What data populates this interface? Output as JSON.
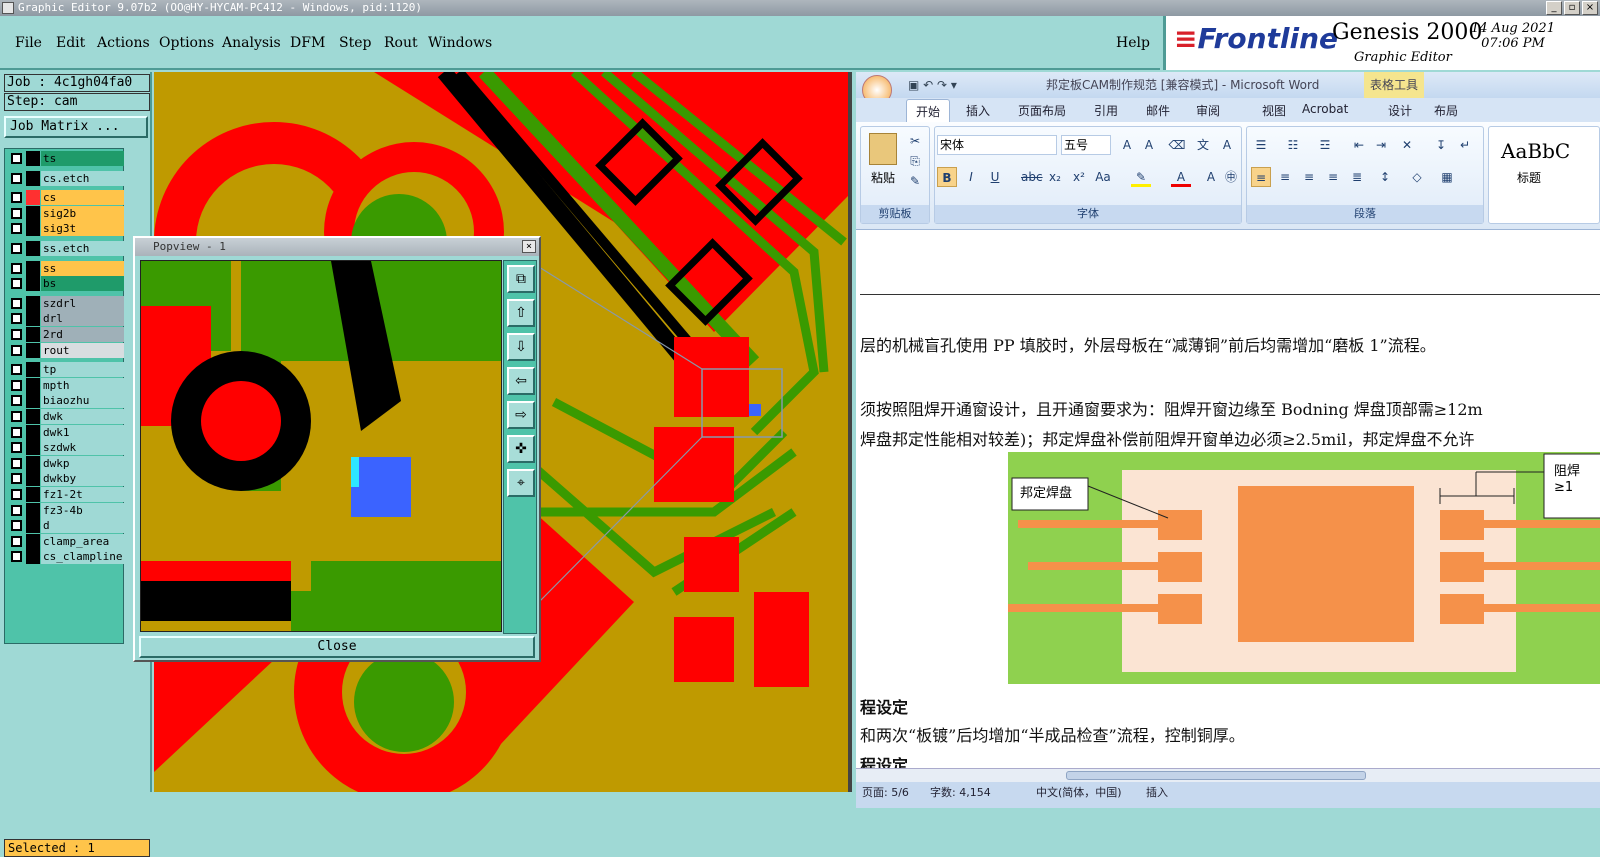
{
  "window": {
    "title": "Graphic Editor 9.07b2 (OO@HY-HYCAM-PC412 - Windows, pid:1120)"
  },
  "menu": {
    "file": "File",
    "edit": "Edit",
    "actions": "Actions",
    "options": "Options",
    "analysis": "Analysis",
    "dfm": "DFM",
    "step": "Step",
    "rout": "Rout",
    "windows": "Windows",
    "help": "Help"
  },
  "brand": {
    "logo": "Frontline",
    "product": "Genesis 2000",
    "subtitle": "Graphic Editor",
    "date": "14 Aug 2021",
    "time": "07:06 PM"
  },
  "job": {
    "job_label": "Job : 4c1gh04fa0",
    "step_label": "Step: cam",
    "matrix_button": "Job Matrix ..."
  },
  "layers": [
    {
      "name": "ts",
      "color": "#1f9b6a"
    },
    {
      "name": "cs.etch",
      "color": "#9fd9d5"
    },
    {
      "name": "cs",
      "color": "#ffc44a"
    },
    {
      "name": "sig2b",
      "color": "#ffc44a"
    },
    {
      "name": "sig3t",
      "color": "#ffc44a"
    },
    {
      "name": "ss.etch",
      "color": "#9fd9d5"
    },
    {
      "name": "ss",
      "color": "#ffc44a"
    },
    {
      "name": "bs",
      "color": "#1f9b6a"
    },
    {
      "name": "szdrl",
      "color": "#9fb0b8"
    },
    {
      "name": "drl",
      "color": "#9fb0b8"
    },
    {
      "name": "2rd",
      "color": "#9fb0b8"
    },
    {
      "name": "rout",
      "color": "#d8dde0"
    },
    {
      "name": "tp",
      "color": "#9fd9d5"
    },
    {
      "name": "mpth",
      "color": "#9fd9d5"
    },
    {
      "name": "biaozhu",
      "color": "#9fd9d5"
    },
    {
      "name": "dwk",
      "color": "#9fd9d5"
    },
    {
      "name": "dwk1",
      "color": "#9fd9d5"
    },
    {
      "name": "szdwk",
      "color": "#9fd9d5"
    },
    {
      "name": "dwkp",
      "color": "#9fd9d5"
    },
    {
      "name": "dwkby",
      "color": "#9fd9d5"
    },
    {
      "name": "fz1-2t",
      "color": "#9fd9d5"
    },
    {
      "name": "fz3-4b",
      "color": "#9fd9d5"
    },
    {
      "name": "d",
      "color": "#9fd9d5"
    },
    {
      "name": "clamp_area",
      "color": "#9fd9d5"
    },
    {
      "name": "cs_clampline",
      "color": "#9fd9d5"
    }
  ],
  "selected": "Selected : 1",
  "popview": {
    "title": "Popview - 1",
    "close_button": "Close"
  },
  "word": {
    "title": "邦定板CAM制作规范 [兼容模式] - Microsoft Word",
    "table_tools": "表格工具",
    "tabs": [
      "开始",
      "插入",
      "页面布局",
      "引用",
      "邮件",
      "审阅",
      "视图",
      "Acrobat",
      "设计",
      "布局"
    ],
    "font_name": "宋体",
    "font_size": "五号",
    "paste": "粘贴",
    "group_clipboard": "剪贴板",
    "group_font": "字体",
    "group_paragraph": "段落",
    "style_preview": "AaBbC",
    "style_name": "标题",
    "line1": "层的机械盲孔使用 PP 填胶时，外层母板在“减薄铜”前后均需增加“磨板 1”流程。",
    "line2": "须按照阻焊开通窗设计，且开通窗要求为：阻焊开窗边缘至 Bodning 焊盘顶部需≥12m",
    "line3": "焊盘邦定性能相对较差)；邦定焊盘补偿前阻焊开窗单边必须≥2.5mil，邦定焊盘不允许",
    "diagram_label": "邦定焊盘",
    "diagram_side": "阻焊",
    "diagram_side2": "≥1",
    "heading1": "程设定",
    "line4": "和两次“板镀”后均增加“半成品检查”流程，控制铜厚。",
    "heading2": "程设定",
    "status_page": "页面: 5/6",
    "status_words": "字数: 4,154",
    "status_lang": "中文(简体，中国)",
    "status_insert": "插入"
  }
}
